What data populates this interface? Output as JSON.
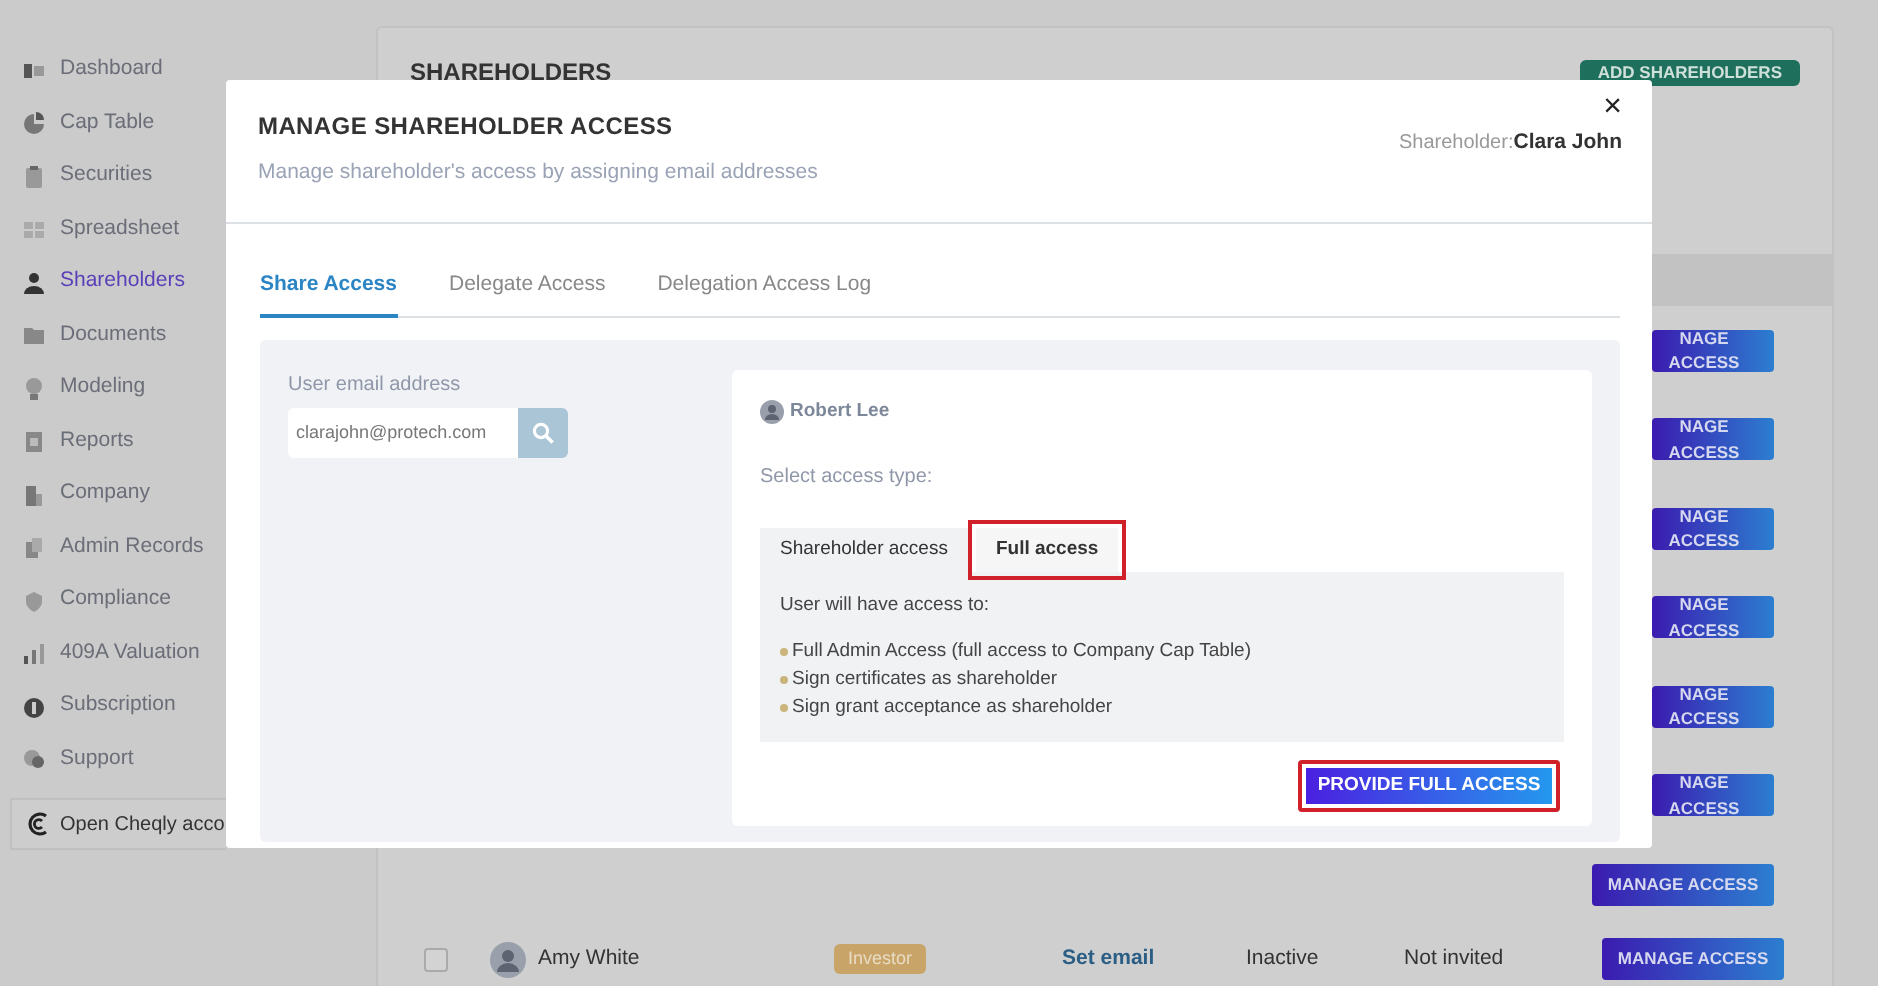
{
  "sidebar": {
    "items": [
      {
        "label": "Dashboard",
        "selected": false
      },
      {
        "label": "Cap Table",
        "selected": false
      },
      {
        "label": "Securities",
        "selected": false
      },
      {
        "label": "Spreadsheet",
        "selected": false
      },
      {
        "label": "Shareholders",
        "selected": true
      },
      {
        "label": "Documents",
        "selected": false
      },
      {
        "label": "Modeling",
        "selected": false
      },
      {
        "label": "Reports",
        "selected": false
      },
      {
        "label": "Company",
        "selected": false
      },
      {
        "label": "Admin Records",
        "selected": false
      },
      {
        "label": "Compliance",
        "selected": false
      },
      {
        "label": "409A Valuation",
        "selected": false
      },
      {
        "label": "Subscription",
        "selected": false
      },
      {
        "label": "Support",
        "selected": false
      }
    ],
    "footer_link": "Open Cheqly acco"
  },
  "page": {
    "title": "SHAREHOLDERS",
    "add_button": "ADD SHAREHOLDERS",
    "rows": [
      {
        "kind": "covered",
        "manage_button": "NAGE ACCESS"
      },
      {
        "kind": "covered",
        "manage_button": "NAGE ACCESS"
      },
      {
        "kind": "covered",
        "manage_button": "NAGE ACCESS"
      },
      {
        "kind": "covered",
        "manage_button": "NAGE ACCESS"
      },
      {
        "kind": "covered",
        "manage_button": "NAGE ACCESS"
      },
      {
        "kind": "covered",
        "manage_button": "NAGE ACCESS"
      },
      {
        "kind": "button_only",
        "manage_button": "MANAGE ACCESS"
      },
      {
        "kind": "full",
        "checked": false,
        "name": "Amy White",
        "badge": "Investor",
        "email_link": "Set email",
        "status": "Inactive",
        "invite": "Not invited",
        "manage_button": "MANAGE ACCESS"
      }
    ]
  },
  "modal": {
    "title": "MANAGE SHAREHOLDER ACCESS",
    "subtitle": "Manage shareholder's access by assigning email addresses",
    "shareholder_label": "Shareholder:",
    "shareholder_name": "Clara John",
    "close": "×",
    "tabs": [
      {
        "label": "Share Access",
        "selected": true
      },
      {
        "label": "Delegate Access",
        "selected": false
      },
      {
        "label": "Delegation Access Log",
        "selected": false
      }
    ],
    "email_label": "User email address",
    "email_value": "clarajohn@protech.com",
    "user_name": "Robert Lee",
    "access_prompt": "Select access type:",
    "access_tabs": [
      {
        "label": "Shareholder access",
        "selected": false,
        "highlighted": false
      },
      {
        "label": "Full access",
        "selected": true,
        "highlighted": true
      }
    ],
    "access_intro": "User will have access to:",
    "access_items": [
      "Full Admin Access (full access to Company Cap Table)",
      "Sign certificates as shareholder",
      "Sign grant acceptance as shareholder"
    ],
    "submit": {
      "label": "PROVIDE FULL ACCESS",
      "highlighted": true
    }
  }
}
